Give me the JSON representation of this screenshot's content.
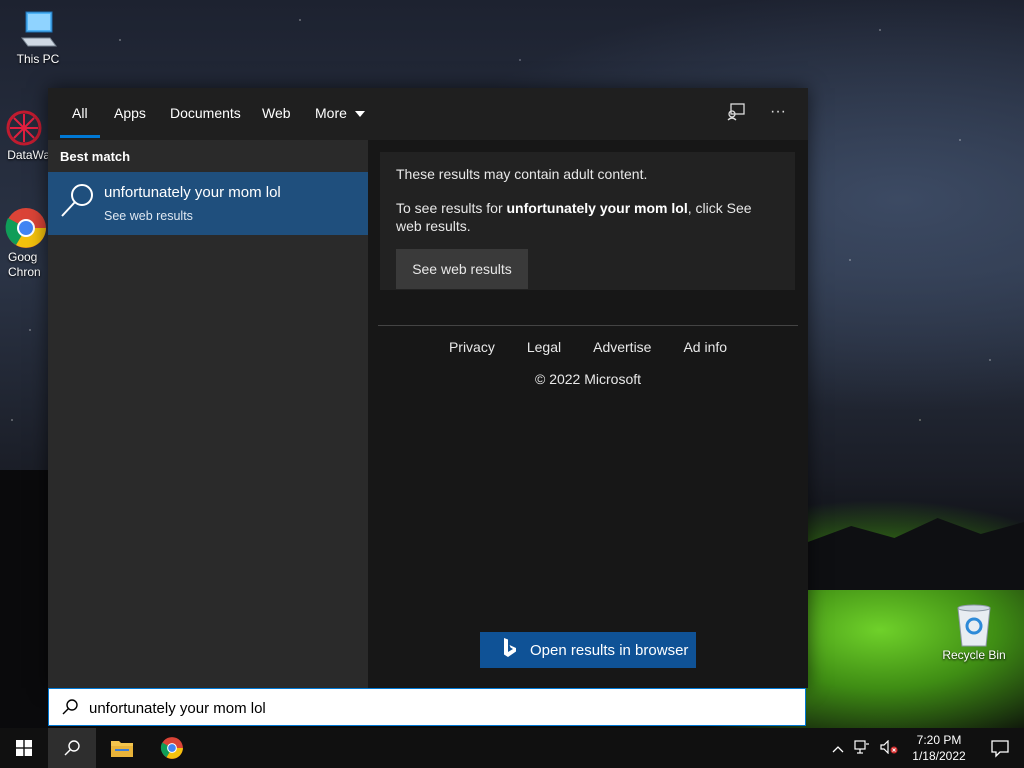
{
  "desktop": {
    "icons": [
      {
        "label": "This PC"
      },
      {
        "label": "DataWag"
      },
      {
        "label": "Goog\nChron"
      },
      {
        "label": "Recycle Bin"
      }
    ]
  },
  "search_panel": {
    "tabs": [
      {
        "label": "All"
      },
      {
        "label": "Apps"
      },
      {
        "label": "Documents"
      },
      {
        "label": "Web"
      },
      {
        "label": "More"
      }
    ],
    "best_match_label": "Best match",
    "best_match": {
      "title": "unfortunately your mom lol",
      "subtitle": "See web results"
    },
    "preview": {
      "warning": "These results may contain adult content.",
      "detail_prefix": "To see results for ",
      "detail_query": "unfortunately your mom lol",
      "detail_suffix": ", click See web results.",
      "see_web_button": "See web results",
      "links": [
        "Privacy",
        "Legal",
        "Advertise",
        "Ad info"
      ],
      "copyright": "© 2022 Microsoft",
      "open_browser_button": "Open results in browser"
    },
    "search_input": {
      "value": "unfortunately your mom lol"
    }
  },
  "taskbar": {
    "time": "7:20 PM",
    "date": "1/18/2022"
  },
  "colors": {
    "accent": "#0078d4",
    "selected_row": "#1f4f7d",
    "open_browser_button": "#0f5296"
  }
}
